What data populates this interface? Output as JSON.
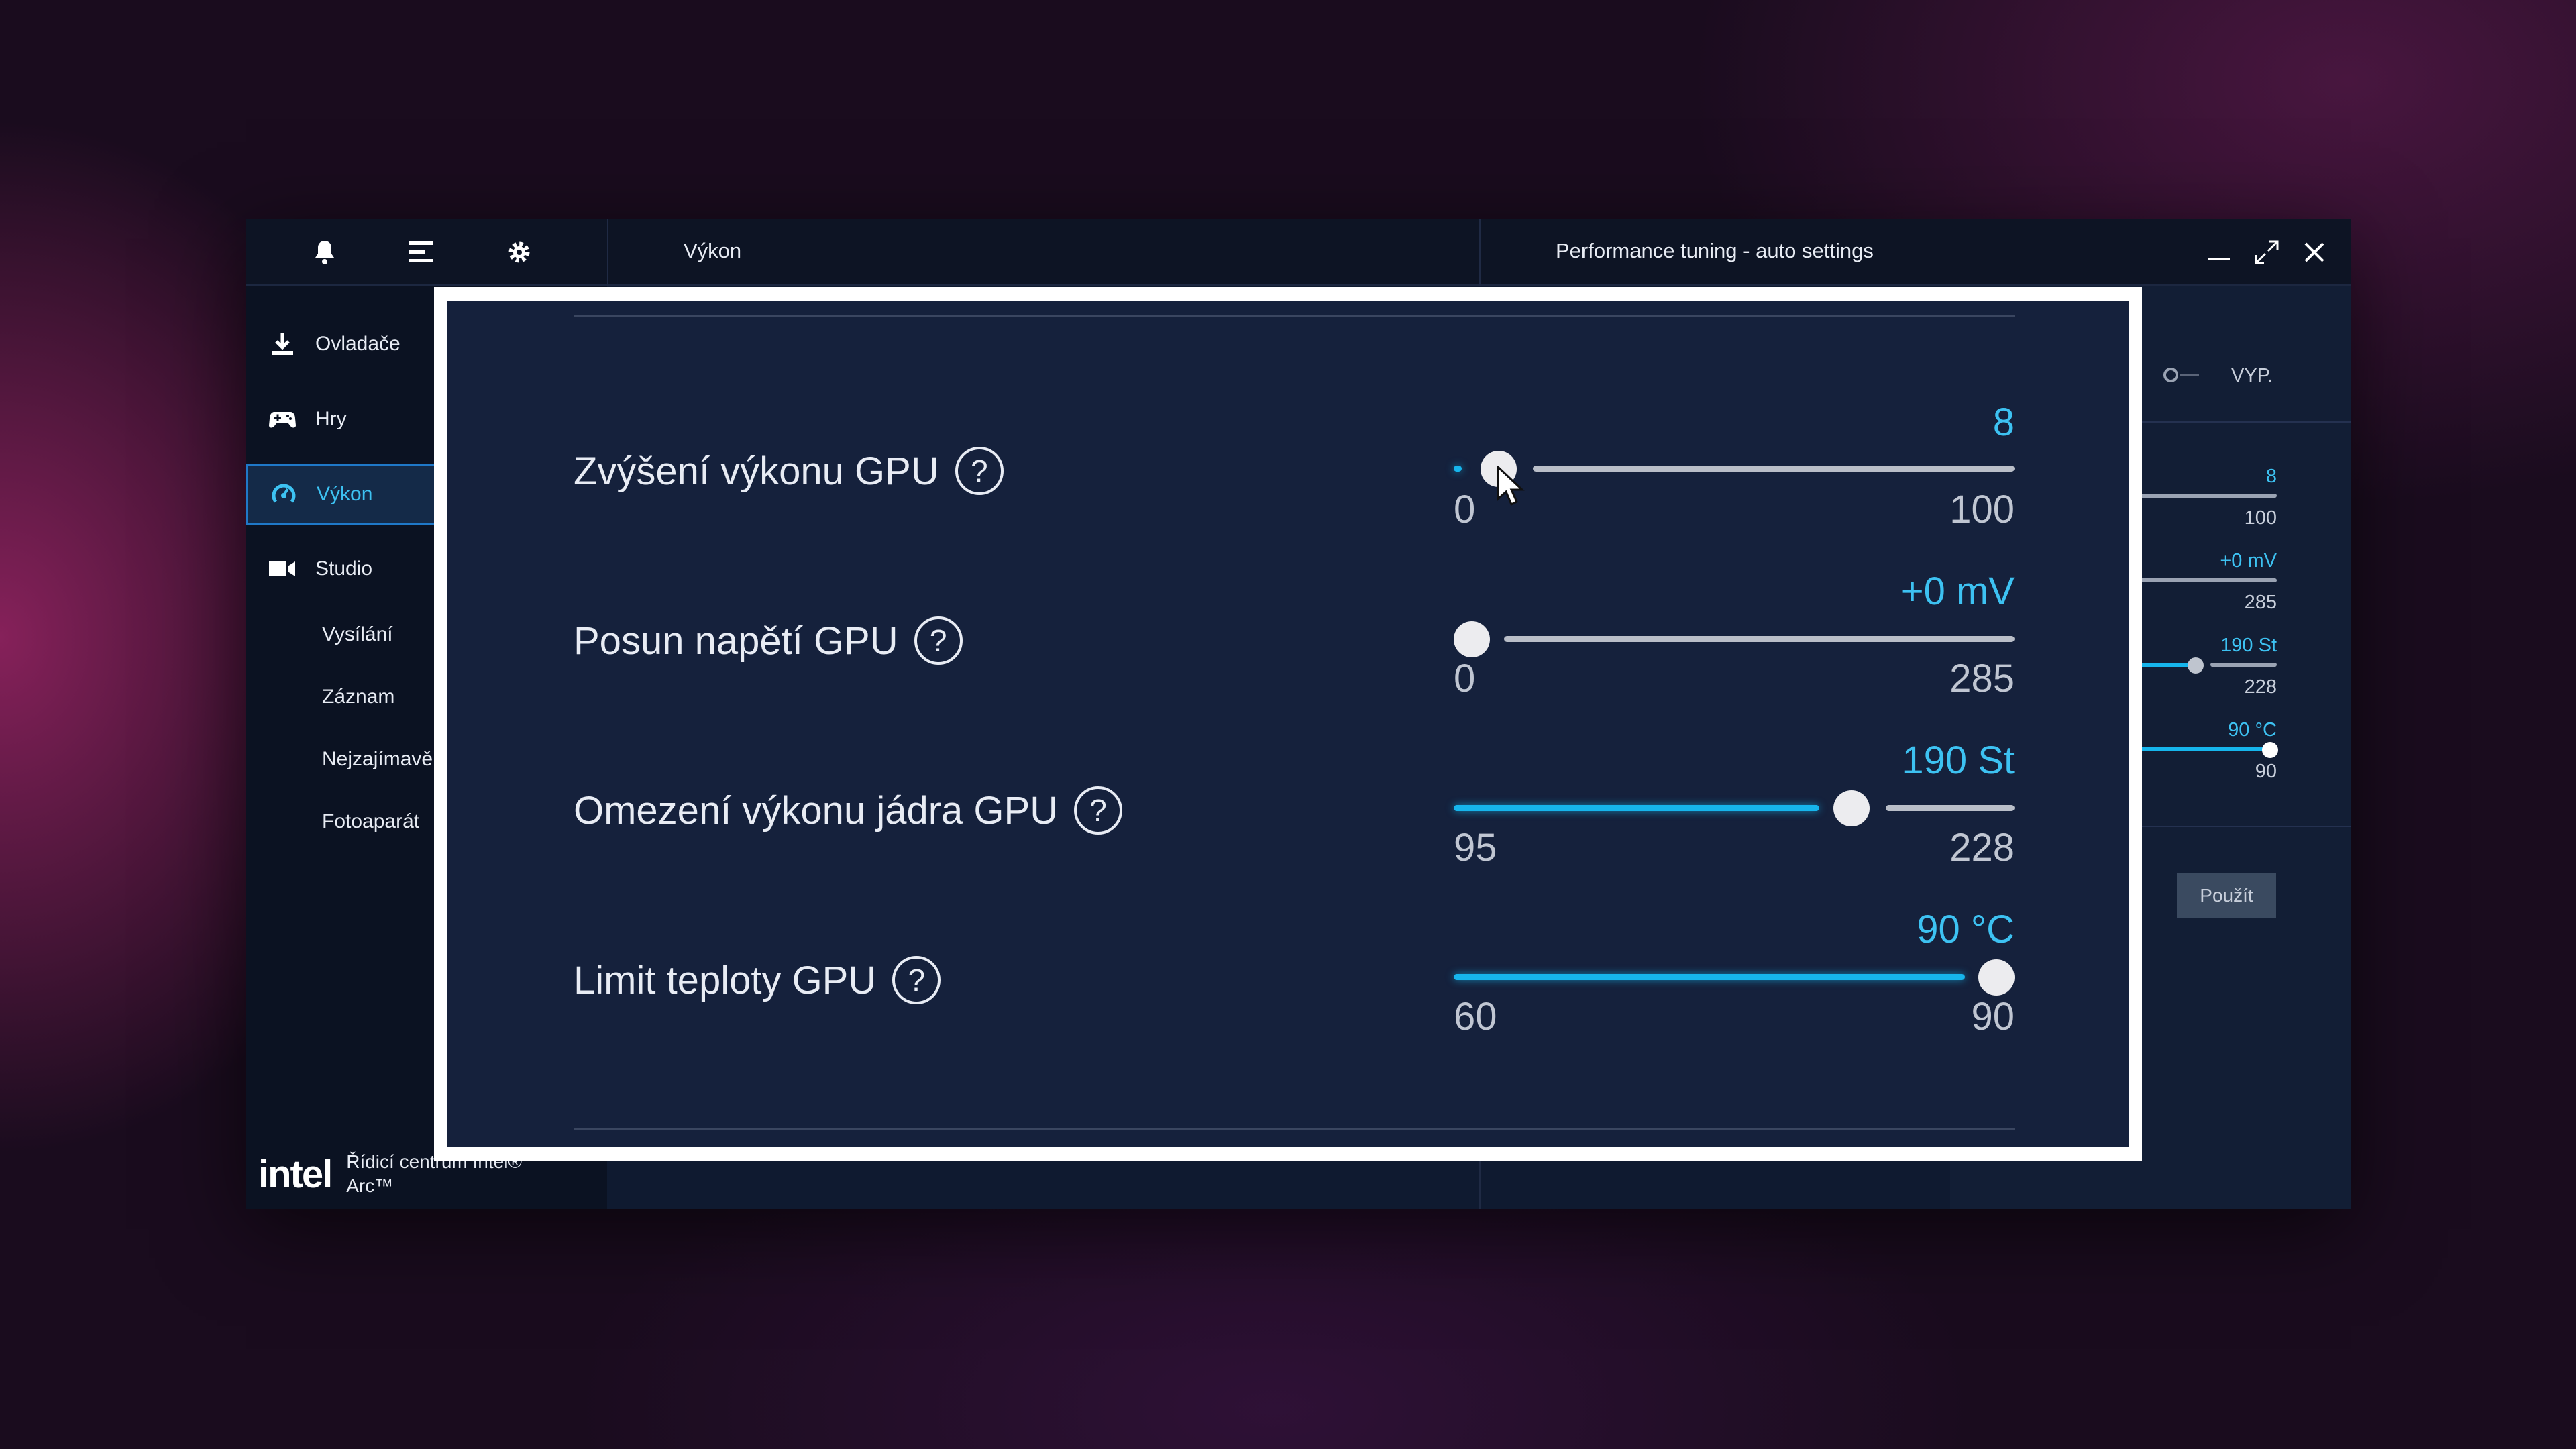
{
  "topbar": {
    "title": "Výkon",
    "panel_title": "Performance tuning - auto settings",
    "icons": [
      "bell-icon",
      "menu-icon",
      "gear-icon"
    ],
    "window_controls": [
      "minimize-icon",
      "expand-icon",
      "close-icon"
    ]
  },
  "sidebar": {
    "items": [
      {
        "label": "Ovladače",
        "icon": "download-icon"
      },
      {
        "label": "Hry",
        "icon": "gamepad-icon"
      },
      {
        "label": "Výkon",
        "icon": "gauge-icon",
        "active": true
      },
      {
        "label": "Studio",
        "icon": "camera-icon"
      }
    ],
    "sub_items": [
      "Vysílání",
      "Záznam",
      "Nejzajímavě",
      "Fotoaparát"
    ],
    "brand": {
      "logo": "intel",
      "text": "Řídicí centrum Intel® Arc™"
    }
  },
  "right_panel": {
    "toggle_label": "VYP.",
    "values": [
      {
        "value": "8",
        "max": "100"
      },
      {
        "value": "+0 mV",
        "max": "285"
      },
      {
        "value": "190 St",
        "max": "228"
      },
      {
        "value": "90 °C",
        "max": "90"
      }
    ],
    "apply_label": "Použít"
  },
  "sliders": [
    {
      "label": "Zvýšení výkonu GPU",
      "value_text": "8",
      "min": "0",
      "max": "100",
      "value": 8,
      "min_num": 0,
      "max_num": 100
    },
    {
      "label": "Posun napětí GPU",
      "value_text": "+0 mV",
      "min": "0",
      "max": "285",
      "value": 0,
      "min_num": 0,
      "max_num": 285
    },
    {
      "label": "Omezení výkonu jádra GPU",
      "value_text": "190 St",
      "min": "95",
      "max": "228",
      "value": 190,
      "min_num": 95,
      "max_num": 228
    },
    {
      "label": "Limit teploty GPU",
      "value_text": "90 °C",
      "min": "60",
      "max": "90",
      "value": 90,
      "min_num": 60,
      "max_num": 90
    }
  ],
  "colors": {
    "accent": "#16b5ec",
    "panel": "#15213c",
    "track": "#b9bec8"
  }
}
